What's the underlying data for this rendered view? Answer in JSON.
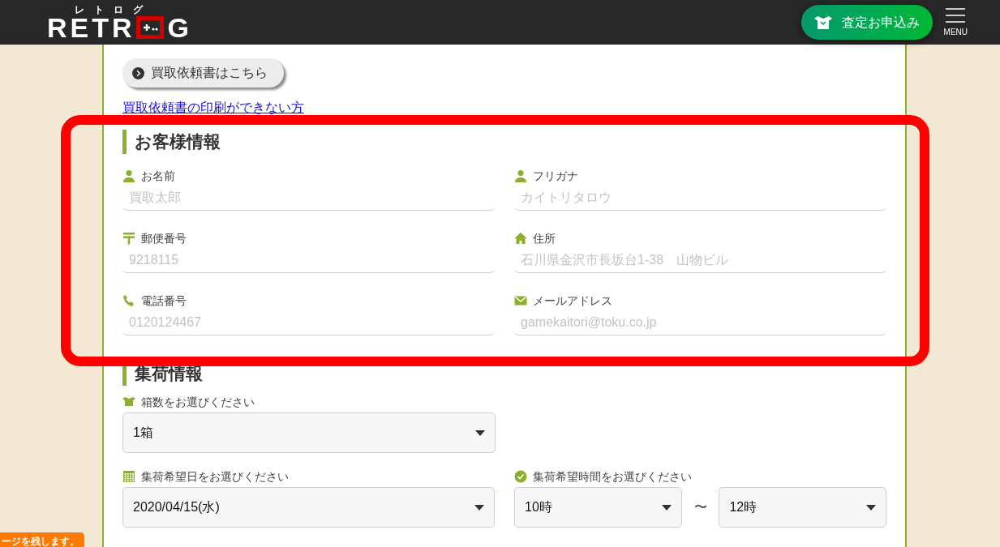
{
  "header": {
    "logo": {
      "ruby": "レ　ト　ロ　グ",
      "before": "RETR",
      "after": "G"
    },
    "apply_button": "査定お申込み",
    "menu_label": "MENU"
  },
  "request_form_button": "買取依頼書はこちら",
  "print_link": "買取依頼書の印刷ができない方",
  "customer_section": {
    "title": "お客様情報",
    "fields": [
      {
        "kind": "name",
        "label": "お名前",
        "placeholder": "買取太郎"
      },
      {
        "kind": "kana",
        "label": "フリガナ",
        "placeholder": "カイトリタロウ"
      },
      {
        "kind": "postal",
        "label": "郵便番号",
        "placeholder": "9218115"
      },
      {
        "kind": "address",
        "label": "住所",
        "placeholder": "石川県金沢市長坂台1-38　山物ビル"
      },
      {
        "kind": "phone",
        "label": "電話番号",
        "placeholder": "0120124467"
      },
      {
        "kind": "email",
        "label": "メールアドレス",
        "placeholder": "gamekaitori@toku.co.jp"
      }
    ]
  },
  "pickup_section": {
    "title": "集荷情報",
    "box_count": {
      "label": "箱数をお選びください",
      "value": "1箱"
    },
    "date": {
      "label": "集荷希望日をお選びください",
      "value": "2020/04/15(水)"
    },
    "time": {
      "label": "集荷希望時間をお選びください",
      "from": "10時",
      "separator": "〜",
      "to": "12時"
    }
  },
  "side_tab": "ージを残します。"
}
